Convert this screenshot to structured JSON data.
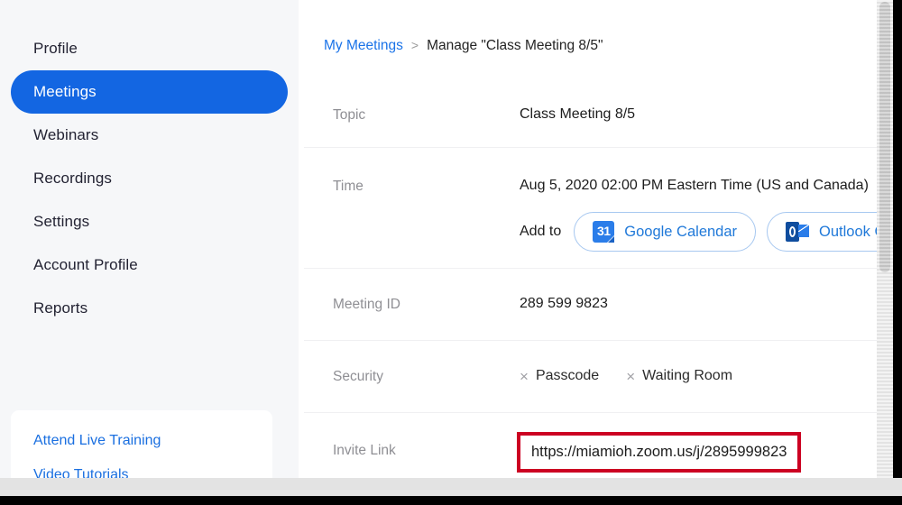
{
  "sidebar": {
    "nav_items": [
      {
        "label": "Profile",
        "active": false
      },
      {
        "label": "Meetings",
        "active": true
      },
      {
        "label": "Webinars",
        "active": false
      },
      {
        "label": "Recordings",
        "active": false
      },
      {
        "label": "Settings",
        "active": false
      },
      {
        "label": "Account Profile",
        "active": false
      },
      {
        "label": "Reports",
        "active": false
      }
    ],
    "help_links": [
      {
        "label": "Attend Live Training"
      },
      {
        "label": "Video Tutorials"
      }
    ],
    "active_accent_color": "#1366e2",
    "link_color": "#1a6fe0",
    "background_color": "#f6f7f9"
  },
  "breadcrumb": {
    "parent_label": "My Meetings",
    "separator": ">",
    "current_label": "Manage \"Class Meeting 8/5\""
  },
  "details": {
    "topic": {
      "label": "Topic",
      "value": "Class Meeting 8/5"
    },
    "time": {
      "label": "Time",
      "value": "Aug 5, 2020 02:00 PM Eastern Time (US and Canada)",
      "add_to_label": "Add to",
      "calendar_buttons": [
        {
          "label": "Google Calendar",
          "icon": "google-calendar-icon",
          "icon_text": "31"
        },
        {
          "label": "Outlook Ca",
          "icon": "outlook-calendar-icon"
        }
      ]
    },
    "meeting_id": {
      "label": "Meeting ID",
      "value": "289 599 9823"
    },
    "security": {
      "label": "Security",
      "items": [
        {
          "mark": "×",
          "label": "Passcode"
        },
        {
          "mark": "×",
          "label": "Waiting Room"
        }
      ]
    },
    "invite_link": {
      "label": "Invite Link",
      "value": "https://miamioh.zoom.us/j/2895999823",
      "highlight_color": "#cc0022"
    }
  },
  "scrollbar": {
    "name": "vertical-scrollbar"
  }
}
